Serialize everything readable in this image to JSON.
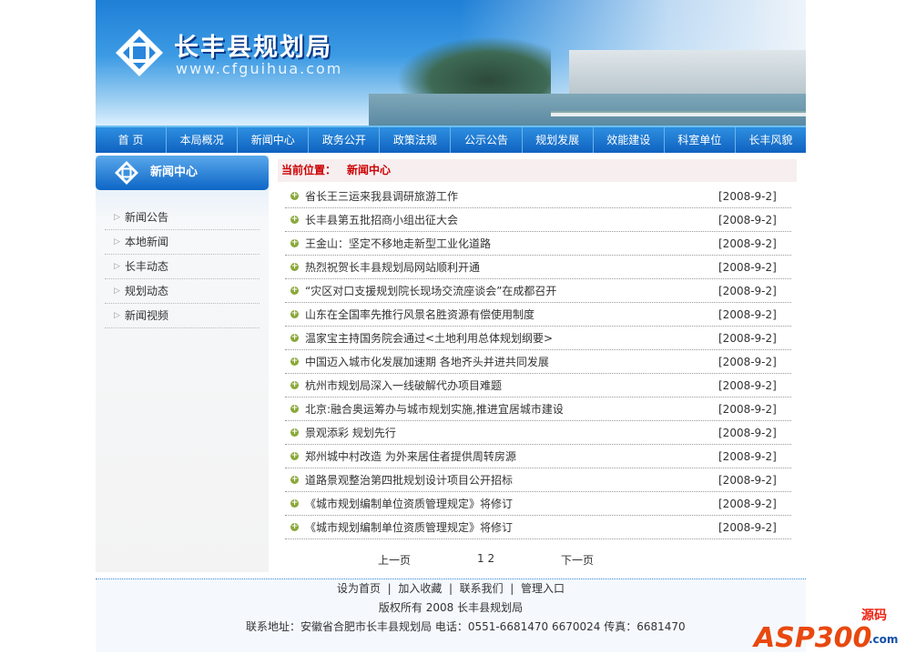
{
  "header": {
    "title": "长丰县规划局",
    "url": "www.cfguihua.com"
  },
  "nav": [
    "首 页",
    "本局概况",
    "新闻中心",
    "政务公开",
    "政策法规",
    "公示公告",
    "规划发展",
    "效能建设",
    "科室单位",
    "长丰风貌"
  ],
  "sidebar": {
    "title": "新闻中心",
    "items": [
      "新闻公告",
      "本地新闻",
      "长丰动态",
      "规划动态",
      "新闻视频"
    ]
  },
  "breadcrumb": {
    "label": "当前位置：",
    "current": "新闻中心"
  },
  "news": [
    {
      "title": "省长王三运来我县调研旅游工作",
      "date": "[2008-9-2]"
    },
    {
      "title": "长丰县第五批招商小组出征大会",
      "date": "[2008-9-2]"
    },
    {
      "title": "王金山：坚定不移地走新型工业化道路",
      "date": "[2008-9-2]"
    },
    {
      "title": "热烈祝贺长丰县规划局网站顺利开通",
      "date": "[2008-9-2]"
    },
    {
      "title": "“灾区对口支援规划院长现场交流座谈会”在成都召开",
      "date": "[2008-9-2]"
    },
    {
      "title": "山东在全国率先推行风景名胜资源有偿使用制度",
      "date": "[2008-9-2]"
    },
    {
      "title": "温家宝主持国务院会通过<土地利用总体规划纲要>",
      "date": "[2008-9-2]"
    },
    {
      "title": "中国迈入城市化发展加速期 各地齐头并进共同发展",
      "date": "[2008-9-2]"
    },
    {
      "title": "杭州市规划局深入一线破解代办项目难题",
      "date": "[2008-9-2]"
    },
    {
      "title": "北京:融合奥运筹办与城市规划实施,推进宜居城市建设",
      "date": "[2008-9-2]"
    },
    {
      "title": "景观添彩 规划先行",
      "date": "[2008-9-2]"
    },
    {
      "title": "郑州城中村改造 为外来居住者提供周转房源",
      "date": "[2008-9-2]"
    },
    {
      "title": "道路景观整治第四批规划设计项目公开招标",
      "date": "[2008-9-2]"
    },
    {
      "title": "《城市规划编制单位资质管理规定》将修订",
      "date": "[2008-9-2]"
    },
    {
      "title": "《城市规划编制单位资质管理规定》将修订",
      "date": "[2008-9-2]"
    }
  ],
  "pager": {
    "prev": "上一页",
    "pages": "1 2",
    "next": "下一页"
  },
  "footer": {
    "links": [
      "设为首页",
      "加入收藏",
      "联系我们",
      "管理入口"
    ],
    "copyright": "版权所有 2008 长丰县规划局",
    "contact": "联系地址：安徽省合肥市长丰县规划局 电话：0551-6681470 6670024 传真：6681470"
  },
  "watermark": {
    "text": "ASP300",
    "sub1": "源码",
    "sub2": ".com"
  }
}
